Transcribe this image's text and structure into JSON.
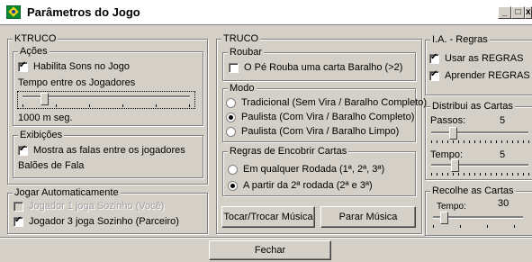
{
  "window": {
    "title": "Parâmetros do Jogo",
    "controls": [
      "_",
      "□",
      "x"
    ]
  },
  "ktruco": {
    "legend": "KTRUCO",
    "acoes": {
      "legend": "Ações",
      "habilitar_sons": {
        "label": "Habilita Sons no Jogo",
        "checked": true
      },
      "tempo_label": "Tempo entre os Jogadores",
      "tempo_value": "1000 m seg."
    },
    "exibicoes": {
      "legend": "Exibições",
      "mostrar_falas": {
        "label": "Mostra as falas entre os jogadores",
        "checked": true
      },
      "baloes_label": "Balões de Fala"
    }
  },
  "jogar_auto": {
    "legend": "Jogar Automaticamente",
    "jogador1": {
      "label": "Jogador 1  joga Sozinho (Você)",
      "checked": false,
      "disabled": true
    },
    "jogador3": {
      "label": "Jogador 3  joga Sozinho (Parceiro)",
      "checked": true
    }
  },
  "truco": {
    "legend": "TRUCO",
    "roubar": {
      "legend": "Roubar",
      "pe_rouba": {
        "label": "O Pé Rouba uma carta Baralho (>2)",
        "checked": false
      }
    },
    "modo": {
      "legend": "Modo",
      "options": [
        "Tradicional (Sem Vira / Baralho Completo)",
        "Paulista (Com Vira / Baralho Completo)",
        "Paulista (Com Vira / Baralho Limpo)"
      ],
      "selected": 1
    },
    "encobrir": {
      "legend": "Regras de Encobrir Cartas",
      "options": [
        "Em qualquer Rodada (1ª, 2ª, 3ª)",
        "A partir da 2ª rodada (2ª e 3ª)"
      ],
      "selected": 1
    },
    "tocar_button": "Tocar/Trocar Música",
    "parar_button": "Parar Música"
  },
  "ia": {
    "legend": "I.A. - Regras",
    "usar_regras": {
      "label": "Usar as REGRAS",
      "checked": true
    },
    "aprender_regras": {
      "label": "Aprender REGRAS",
      "checked": true
    }
  },
  "distribui": {
    "legend": "Distribui as Cartas",
    "passos_label": "Passos:",
    "passos_value": "5",
    "tempo_label": "Tempo:",
    "tempo_value": "5"
  },
  "recolhe": {
    "legend": "Recolhe as Cartas",
    "tempo_label": "Tempo:",
    "tempo_value": "30"
  },
  "footer": {
    "fechar_button": "Fechar"
  }
}
